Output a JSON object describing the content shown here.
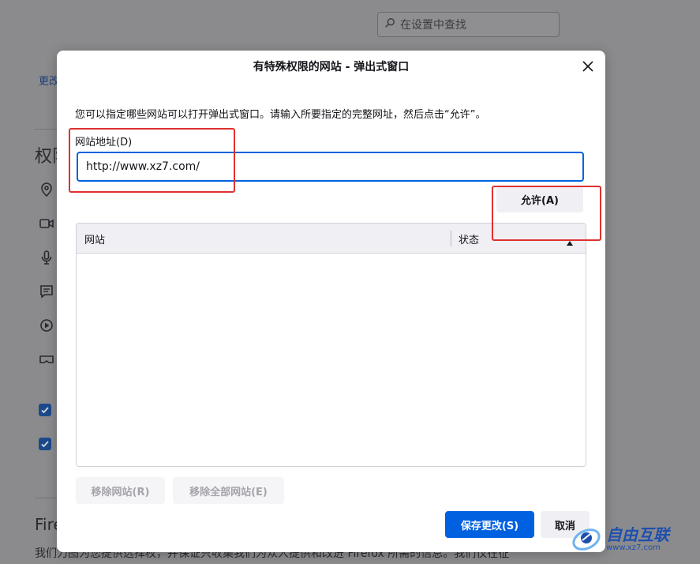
{
  "background": {
    "search_placeholder": "在设置中查找",
    "link_partial": "更改",
    "section_heading_partial": "权限",
    "firefox_heading_partial": "Fire",
    "footer_text": "我们力图为您提供选择权，并保证只收集我们为众人提供和改进 Firefox 所需的信息。我们仅在征"
  },
  "dialog": {
    "title": "有特殊权限的网站 - 弹出式窗口",
    "description": "您可以指定哪些网站可以打开弹出式窗口。请输入所要指定的完整网址，然后点击“允许”。",
    "address_label": "网站地址(D)",
    "address_value": "http://www.xz7.com/",
    "allow_button": "允许(A)",
    "table": {
      "columns": [
        "网站",
        "状态"
      ],
      "rows": []
    },
    "remove_button": "移除网站(R)",
    "remove_all_button": "移除全部网站(E)",
    "save_button": "保存更改(S)",
    "cancel_button": "取消"
  },
  "watermark": {
    "name": "自由互联",
    "url": "www.xz7.com"
  },
  "colors": {
    "accent": "#0061e0",
    "annotation": "#e03030",
    "overlay": "#8b8b8d"
  }
}
